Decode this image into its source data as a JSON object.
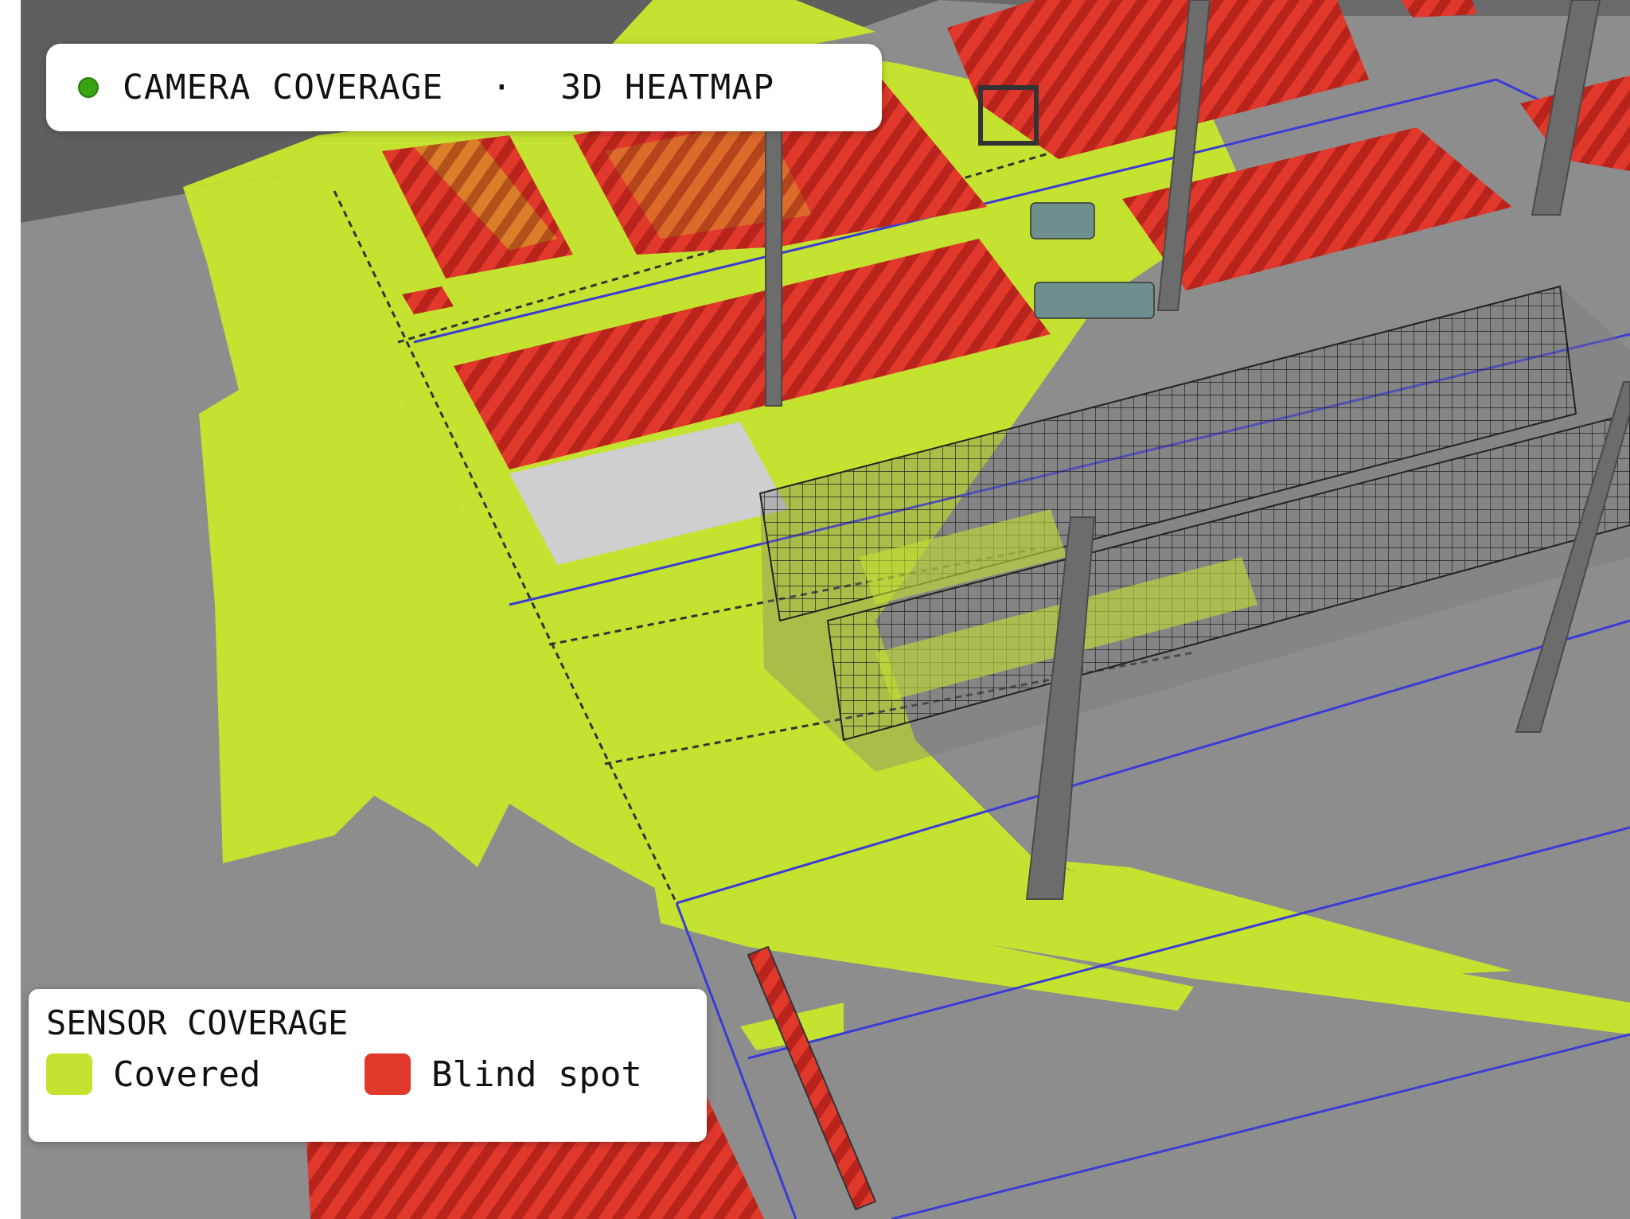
{
  "header": {
    "title": "CAMERA COVERAGE",
    "separator": "·",
    "mode": "3D HEATMAP",
    "status_dot_color": "#3aa312"
  },
  "legend": {
    "title": "SENSOR COVERAGE",
    "items": [
      {
        "label": "Covered",
        "color": "#c3e330"
      },
      {
        "label": "Blind spot",
        "color": "#e0392c"
      }
    ]
  },
  "scene": {
    "floor_color": "#8d8d8d",
    "covered_color": "#c3e330",
    "blind_color": "#e0392c",
    "blind_stripe_color": "#b8241c",
    "wall_color": "#5f5f5f",
    "lane_color": "#3b3bd6",
    "pillar_color": "#6c6c6c",
    "rack_color": "#222222"
  }
}
